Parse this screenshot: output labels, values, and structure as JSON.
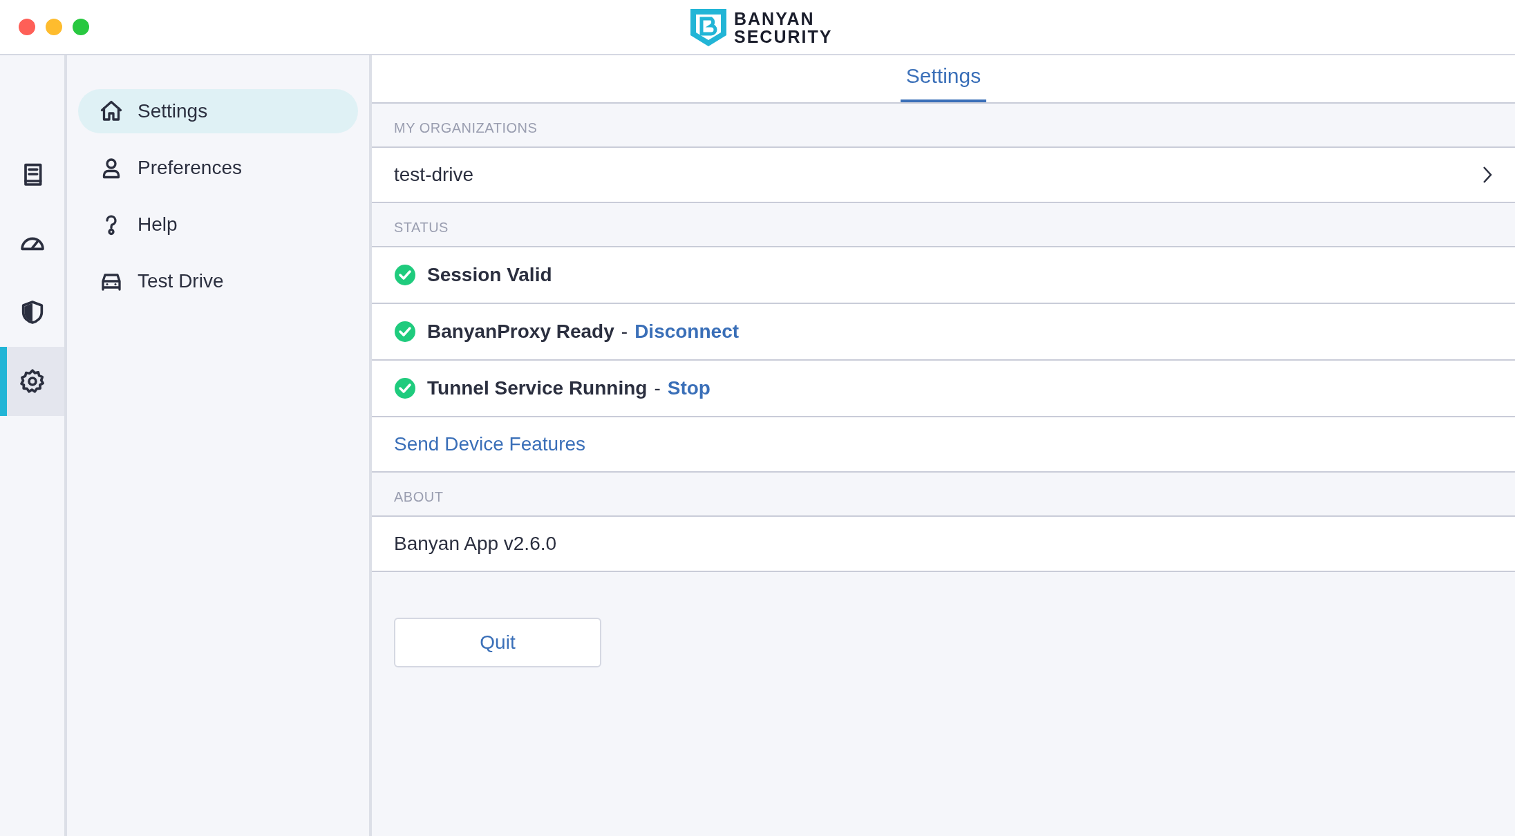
{
  "window": {
    "logo_lines": [
      "BANYAN",
      "SECURITY"
    ]
  },
  "rail": [
    {
      "kind": "book",
      "selected": false
    },
    {
      "kind": "gauge",
      "selected": false
    },
    {
      "kind": "shield",
      "selected": false
    },
    {
      "kind": "gear",
      "selected": true
    }
  ],
  "sidebar": {
    "items": [
      {
        "label": "Settings",
        "kind": "home",
        "selected": true
      },
      {
        "label": "Preferences",
        "kind": "person",
        "selected": false
      },
      {
        "label": "Help",
        "kind": "help",
        "selected": false
      },
      {
        "label": "Test Drive",
        "kind": "car",
        "selected": false
      }
    ]
  },
  "tabs": [
    {
      "label": "Settings",
      "selected": true
    }
  ],
  "sections": [
    {
      "title": "MY ORGANIZATIONS",
      "rows": [
        {
          "kind": "nav",
          "label": "test-drive"
        }
      ]
    },
    {
      "title": "STATUS",
      "rows": [
        {
          "kind": "status",
          "label": "Session Valid",
          "ok": true
        },
        {
          "kind": "status",
          "label": "BanyanProxy Ready",
          "ok": true,
          "separator": "-",
          "action": "Disconnect"
        },
        {
          "kind": "status",
          "label": "Tunnel Service Running",
          "ok": true,
          "separator": "-",
          "action": "Stop"
        },
        {
          "kind": "link",
          "label": "Send Device Features"
        }
      ]
    },
    {
      "title": "ABOUT",
      "rows": [
        {
          "kind": "text",
          "label": "Banyan App v2.6.0"
        }
      ]
    }
  ],
  "buttons": [
    "Quit"
  ]
}
